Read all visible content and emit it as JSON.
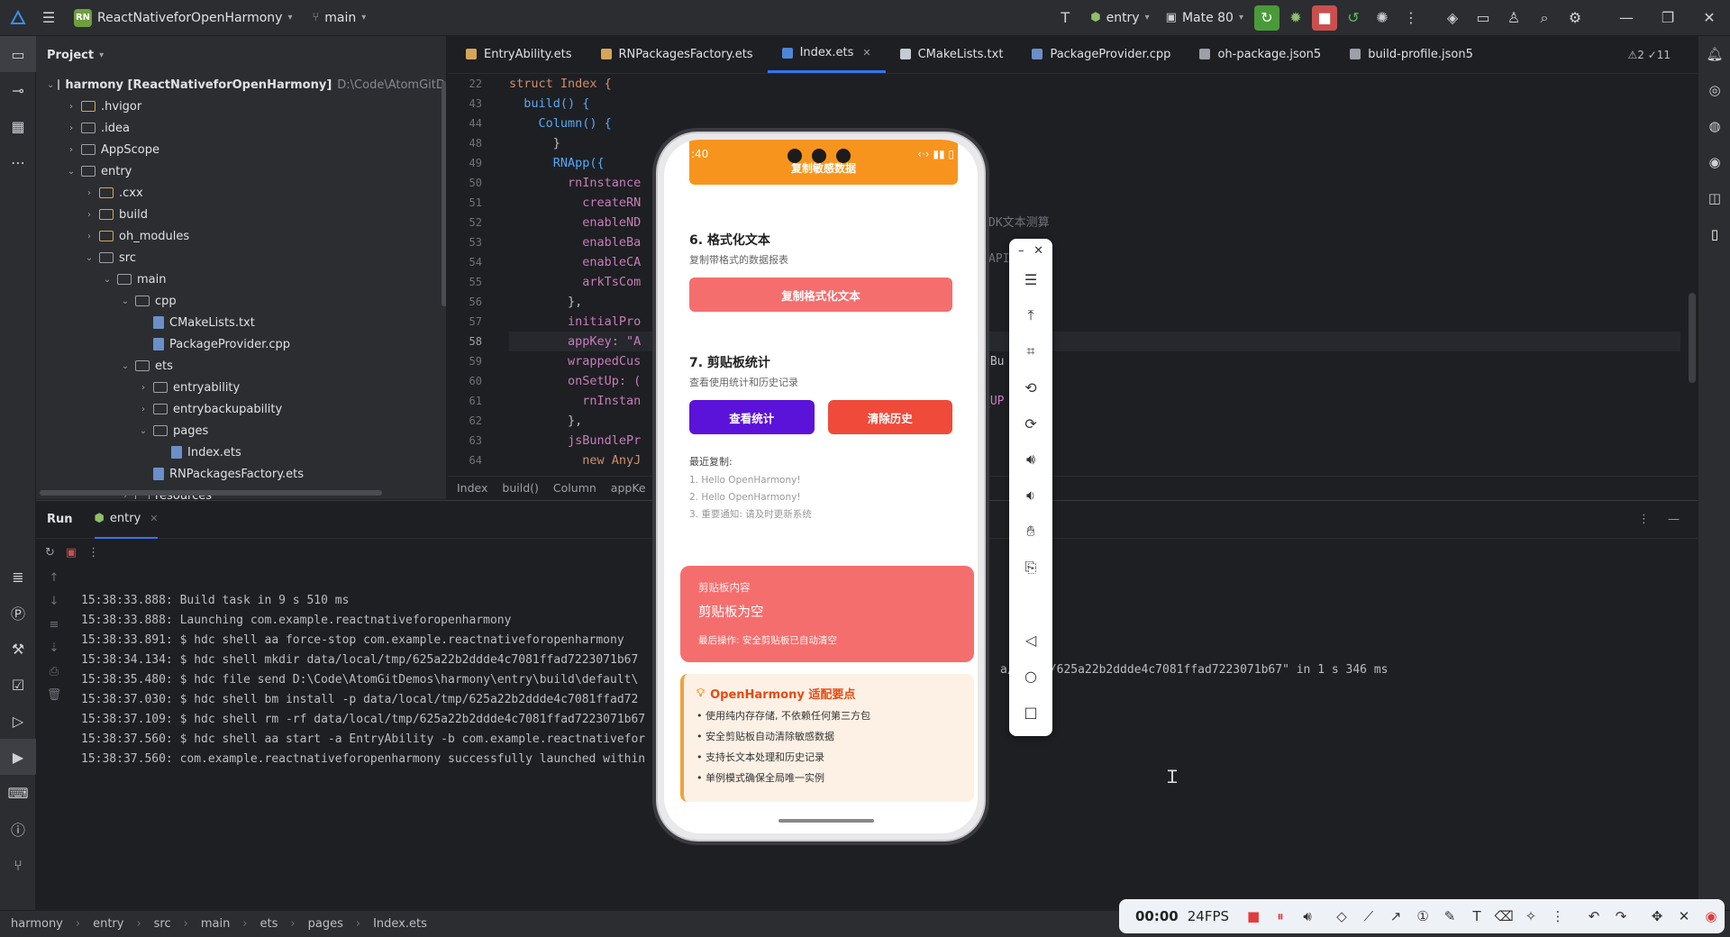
{
  "titlebar": {
    "project_badge": "RN",
    "project_name": "ReactNativeforOpenHarmony",
    "branch": "main",
    "run_config": "entry",
    "device": "Mate 80"
  },
  "project_panel": {
    "title": "Project",
    "tree": [
      {
        "label": "harmony [ReactNativeforOpenHarmony]",
        "extra": "D:\\Code\\AtomGitDemos\\",
        "depth": 0,
        "type": "folder",
        "open": true
      },
      {
        "label": ".hvigor",
        "depth": 1,
        "type": "folder-y",
        "open": false
      },
      {
        "label": ".idea",
        "depth": 1,
        "type": "folder",
        "open": false
      },
      {
        "label": "AppScope",
        "depth": 1,
        "type": "folder",
        "open": false
      },
      {
        "label": "entry",
        "depth": 1,
        "type": "folder",
        "open": true
      },
      {
        "label": ".cxx",
        "depth": 2,
        "type": "folder-y",
        "open": false
      },
      {
        "label": "build",
        "depth": 2,
        "type": "folder-y",
        "open": false
      },
      {
        "label": "oh_modules",
        "depth": 2,
        "type": "folder-y",
        "open": false
      },
      {
        "label": "src",
        "depth": 2,
        "type": "folder",
        "open": true
      },
      {
        "label": "main",
        "depth": 3,
        "type": "folder",
        "open": true
      },
      {
        "label": "cpp",
        "depth": 4,
        "type": "folder",
        "open": true
      },
      {
        "label": "CMakeLists.txt",
        "depth": 5,
        "type": "file",
        "open": null
      },
      {
        "label": "PackageProvider.cpp",
        "depth": 5,
        "type": "file",
        "open": null
      },
      {
        "label": "ets",
        "depth": 4,
        "type": "folder",
        "open": true
      },
      {
        "label": "entryability",
        "depth": 5,
        "type": "folder",
        "open": false
      },
      {
        "label": "entrybackupability",
        "depth": 5,
        "type": "folder",
        "open": false
      },
      {
        "label": "pages",
        "depth": 5,
        "type": "folder",
        "open": true
      },
      {
        "label": "Index.ets",
        "depth": 6,
        "type": "file",
        "open": null
      },
      {
        "label": "RNPackagesFactory.ets",
        "depth": 5,
        "type": "file",
        "open": null
      },
      {
        "label": "resources",
        "depth": 4,
        "type": "folder",
        "open": false
      }
    ]
  },
  "editor": {
    "tabs": [
      "EntryAbility.ets",
      "RNPackagesFactory.ets",
      "Index.ets",
      "CMakeLists.txt",
      "PackageProvider.cpp",
      "oh-package.json5",
      "build-profile.json5"
    ],
    "active_tab": "Index.ets",
    "inspection": "⚠2 ✓11",
    "line_numbers": [
      "22",
      "43",
      "44",
      "48",
      "49",
      "50",
      "51",
      "52",
      "53",
      "54",
      "55",
      "56",
      "57",
      "58",
      "59",
      "60",
      "61",
      "62",
      "63",
      "64"
    ],
    "code_lines": [
      "struct Index {",
      "  build() {",
      "    Column() {",
      "      }",
      "      RNApp({",
      "        rnInstance",
      "          createRN",
      "          enableND",
      "          enableBa",
      "          enableCA",
      "          arkTsCom",
      "        },",
      "        initialPro",
      "        appKey: \"A",
      "        wrappedCus",
      "        onSetUp: (",
      "          rnInstan",
      "        },",
      "        jsBundlePr",
      "          new AnyJ"
    ],
    "current_line": "58",
    "hidden_right_fragments": [
      "DK文本测算",
      "API",
      "tBu",
      "_UP"
    ],
    "breadcrumbs": [
      "Index",
      "build()",
      "Column",
      "appKe"
    ]
  },
  "run_panel": {
    "tab_run": "Run",
    "tab_config": "entry",
    "console": [
      "15:38:33.888: Build task in 9 s 510 ms",
      "15:38:33.888: Launching com.example.reactnativeforopenharmony",
      "15:38:33.891: $ hdc shell aa force-stop com.example.reactnativeforopenharmony",
      "15:38:34.134: $ hdc shell mkdir data/local/tmp/625a22b2ddde4c7081ffad7223071b67",
      "15:38:35.480: $ hdc file send D:\\Code\\AtomGitDemos\\harmony\\entry\\build\\default\\",
      "15:38:37.030: $ hdc shell bm install -p data/local/tmp/625a22b2ddde4c7081ffad72",
      "15:38:37.109: $ hdc shell rm -rf data/local/tmp/625a22b2ddde4c7081ffad7223071b67",
      "15:38:37.560: $ hdc shell aa start -a EntryAbility -b com.example.reactnativefor",
      "15:38:37.560: com.example.reactnativeforopenharmony successfully launched within"
    ],
    "console_tail": "a/l  mp/625a22b2ddde4c7081ffad7223071b67\" in 1 s 346 ms"
  },
  "statusbar": {
    "path": [
      "harmony",
      "entry",
      "src",
      "main",
      "ets",
      "pages",
      "Index.ets"
    ]
  },
  "recorder": {
    "time": "00:00",
    "fps": "24FPS"
  },
  "phone": {
    "status_time": ":40",
    "top_button": "复制敏感数据",
    "section6": {
      "title": "6. 格式化文本",
      "subtitle": "复制带格式的数据报表",
      "button": "复制格式化文本"
    },
    "section7": {
      "title": "7. 剪贴板统计",
      "subtitle": "查看使用统计和历史记录",
      "btn_stats": "查看统计",
      "btn_clear": "清除历史",
      "recent_label": "最近复制:",
      "recent": [
        "1. Hello OpenHarmony!",
        "2. Hello OpenHarmony!",
        "3. 重要通知: 请及时更新系统"
      ]
    },
    "clipboard_card": {
      "label": "剪贴板内容",
      "value": "剪贴板为空",
      "last_op": "最后操作: 安全剪贴板已自动清空"
    },
    "tips": {
      "title": "OpenHarmony 适配要点",
      "items": [
        "使用纯内存存储, 不依赖任何第三方包",
        "安全剪贴板自动清除敏感数据",
        "支持长文本处理和历史记录",
        "单例模式确保全局唯一实例"
      ]
    }
  },
  "colors": {
    "orange": "#f7941d",
    "coral": "#f56e6e",
    "purple": "#5b12d9",
    "red": "#ef4a3a",
    "accent": "#3574f0"
  }
}
